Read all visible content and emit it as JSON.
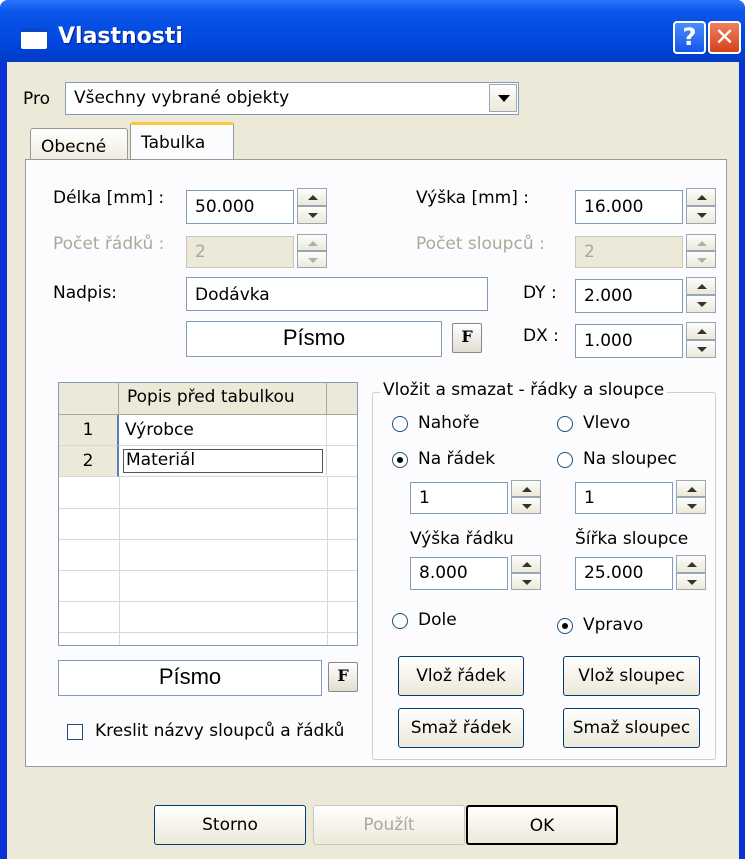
{
  "window": {
    "title": "Vlastnosti",
    "help_label": "?",
    "close_label": "✕"
  },
  "pro": {
    "label": "Pro",
    "value": "Všechny vybrané objekty"
  },
  "tabs": [
    {
      "label": "Obecné"
    },
    {
      "label": "Tabulka"
    }
  ],
  "table_props": {
    "delka_label": "Délka [mm] :",
    "delka_value": "50.000",
    "vyska_label": "Výška [mm] :",
    "vyska_value": "16.000",
    "pocet_radku_label": "Počet řádků :",
    "pocet_radku_value": "2",
    "pocet_sloupcu_label": "Počet sloupců :",
    "pocet_sloupcu_value": "2",
    "nadpis_label": "Nadpis:",
    "nadpis_value": "Dodávka",
    "dy_label": "DY :",
    "dy_value": "2.000",
    "dx_label": "DX :",
    "dx_value": "1.000",
    "font_label": "Písmo",
    "font_button": "F"
  },
  "grid": {
    "header": "Popis před tabulkou",
    "rows": [
      {
        "num": "1",
        "text": "Výrobce"
      },
      {
        "num": "2",
        "text": "Materiál"
      }
    ],
    "font_label": "Písmo",
    "font_button": "F"
  },
  "draw_names": {
    "label": "Kreslit názvy sloupců a řádků",
    "checked": false
  },
  "insert_delete": {
    "title": "Vložit a smazat - řádky a sloupce",
    "nahore": "Nahoře",
    "vlevo": "Vlevo",
    "na_radek": "Na řádek",
    "na_sloupec": "Na sloupec",
    "radek_value": "1",
    "sloupec_value": "1",
    "vyska_radku_label": "Výška řádku",
    "vyska_radku_value": "8.000",
    "sirka_sloupce_label": "Šířka sloupce",
    "sirka_sloupce_value": "25.000",
    "dole": "Dole",
    "vpravo": "Vpravo",
    "vloz_radek": "Vlož řádek",
    "vloz_sloupec": "Vlož sloupec",
    "smaz_radek": "Smaž řádek",
    "smaz_sloupec": "Smaž sloupec"
  },
  "footer": {
    "storno": "Storno",
    "pouzit": "Použít",
    "ok": "OK"
  }
}
